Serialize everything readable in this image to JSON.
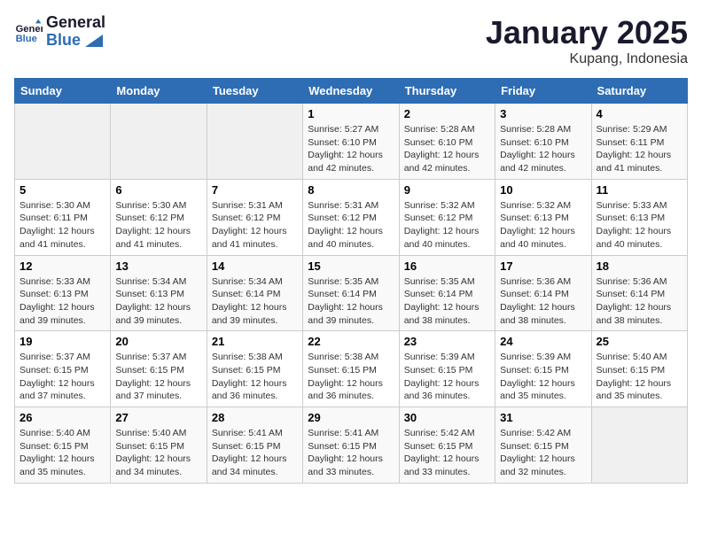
{
  "header": {
    "logo_line1": "General",
    "logo_line2": "Blue",
    "title": "January 2025",
    "subtitle": "Kupang, Indonesia"
  },
  "weekdays": [
    "Sunday",
    "Monday",
    "Tuesday",
    "Wednesday",
    "Thursday",
    "Friday",
    "Saturday"
  ],
  "weeks": [
    [
      {
        "day": "",
        "sunrise": "",
        "sunset": "",
        "daylight": ""
      },
      {
        "day": "",
        "sunrise": "",
        "sunset": "",
        "daylight": ""
      },
      {
        "day": "",
        "sunrise": "",
        "sunset": "",
        "daylight": ""
      },
      {
        "day": "1",
        "sunrise": "Sunrise: 5:27 AM",
        "sunset": "Sunset: 6:10 PM",
        "daylight": "Daylight: 12 hours and 42 minutes."
      },
      {
        "day": "2",
        "sunrise": "Sunrise: 5:28 AM",
        "sunset": "Sunset: 6:10 PM",
        "daylight": "Daylight: 12 hours and 42 minutes."
      },
      {
        "day": "3",
        "sunrise": "Sunrise: 5:28 AM",
        "sunset": "Sunset: 6:10 PM",
        "daylight": "Daylight: 12 hours and 42 minutes."
      },
      {
        "day": "4",
        "sunrise": "Sunrise: 5:29 AM",
        "sunset": "Sunset: 6:11 PM",
        "daylight": "Daylight: 12 hours and 41 minutes."
      }
    ],
    [
      {
        "day": "5",
        "sunrise": "Sunrise: 5:30 AM",
        "sunset": "Sunset: 6:11 PM",
        "daylight": "Daylight: 12 hours and 41 minutes."
      },
      {
        "day": "6",
        "sunrise": "Sunrise: 5:30 AM",
        "sunset": "Sunset: 6:12 PM",
        "daylight": "Daylight: 12 hours and 41 minutes."
      },
      {
        "day": "7",
        "sunrise": "Sunrise: 5:31 AM",
        "sunset": "Sunset: 6:12 PM",
        "daylight": "Daylight: 12 hours and 41 minutes."
      },
      {
        "day": "8",
        "sunrise": "Sunrise: 5:31 AM",
        "sunset": "Sunset: 6:12 PM",
        "daylight": "Daylight: 12 hours and 40 minutes."
      },
      {
        "day": "9",
        "sunrise": "Sunrise: 5:32 AM",
        "sunset": "Sunset: 6:12 PM",
        "daylight": "Daylight: 12 hours and 40 minutes."
      },
      {
        "day": "10",
        "sunrise": "Sunrise: 5:32 AM",
        "sunset": "Sunset: 6:13 PM",
        "daylight": "Daylight: 12 hours and 40 minutes."
      },
      {
        "day": "11",
        "sunrise": "Sunrise: 5:33 AM",
        "sunset": "Sunset: 6:13 PM",
        "daylight": "Daylight: 12 hours and 40 minutes."
      }
    ],
    [
      {
        "day": "12",
        "sunrise": "Sunrise: 5:33 AM",
        "sunset": "Sunset: 6:13 PM",
        "daylight": "Daylight: 12 hours and 39 minutes."
      },
      {
        "day": "13",
        "sunrise": "Sunrise: 5:34 AM",
        "sunset": "Sunset: 6:13 PM",
        "daylight": "Daylight: 12 hours and 39 minutes."
      },
      {
        "day": "14",
        "sunrise": "Sunrise: 5:34 AM",
        "sunset": "Sunset: 6:14 PM",
        "daylight": "Daylight: 12 hours and 39 minutes."
      },
      {
        "day": "15",
        "sunrise": "Sunrise: 5:35 AM",
        "sunset": "Sunset: 6:14 PM",
        "daylight": "Daylight: 12 hours and 39 minutes."
      },
      {
        "day": "16",
        "sunrise": "Sunrise: 5:35 AM",
        "sunset": "Sunset: 6:14 PM",
        "daylight": "Daylight: 12 hours and 38 minutes."
      },
      {
        "day": "17",
        "sunrise": "Sunrise: 5:36 AM",
        "sunset": "Sunset: 6:14 PM",
        "daylight": "Daylight: 12 hours and 38 minutes."
      },
      {
        "day": "18",
        "sunrise": "Sunrise: 5:36 AM",
        "sunset": "Sunset: 6:14 PM",
        "daylight": "Daylight: 12 hours and 38 minutes."
      }
    ],
    [
      {
        "day": "19",
        "sunrise": "Sunrise: 5:37 AM",
        "sunset": "Sunset: 6:15 PM",
        "daylight": "Daylight: 12 hours and 37 minutes."
      },
      {
        "day": "20",
        "sunrise": "Sunrise: 5:37 AM",
        "sunset": "Sunset: 6:15 PM",
        "daylight": "Daylight: 12 hours and 37 minutes."
      },
      {
        "day": "21",
        "sunrise": "Sunrise: 5:38 AM",
        "sunset": "Sunset: 6:15 PM",
        "daylight": "Daylight: 12 hours and 36 minutes."
      },
      {
        "day": "22",
        "sunrise": "Sunrise: 5:38 AM",
        "sunset": "Sunset: 6:15 PM",
        "daylight": "Daylight: 12 hours and 36 minutes."
      },
      {
        "day": "23",
        "sunrise": "Sunrise: 5:39 AM",
        "sunset": "Sunset: 6:15 PM",
        "daylight": "Daylight: 12 hours and 36 minutes."
      },
      {
        "day": "24",
        "sunrise": "Sunrise: 5:39 AM",
        "sunset": "Sunset: 6:15 PM",
        "daylight": "Daylight: 12 hours and 35 minutes."
      },
      {
        "day": "25",
        "sunrise": "Sunrise: 5:40 AM",
        "sunset": "Sunset: 6:15 PM",
        "daylight": "Daylight: 12 hours and 35 minutes."
      }
    ],
    [
      {
        "day": "26",
        "sunrise": "Sunrise: 5:40 AM",
        "sunset": "Sunset: 6:15 PM",
        "daylight": "Daylight: 12 hours and 35 minutes."
      },
      {
        "day": "27",
        "sunrise": "Sunrise: 5:40 AM",
        "sunset": "Sunset: 6:15 PM",
        "daylight": "Daylight: 12 hours and 34 minutes."
      },
      {
        "day": "28",
        "sunrise": "Sunrise: 5:41 AM",
        "sunset": "Sunset: 6:15 PM",
        "daylight": "Daylight: 12 hours and 34 minutes."
      },
      {
        "day": "29",
        "sunrise": "Sunrise: 5:41 AM",
        "sunset": "Sunset: 6:15 PM",
        "daylight": "Daylight: 12 hours and 33 minutes."
      },
      {
        "day": "30",
        "sunrise": "Sunrise: 5:42 AM",
        "sunset": "Sunset: 6:15 PM",
        "daylight": "Daylight: 12 hours and 33 minutes."
      },
      {
        "day": "31",
        "sunrise": "Sunrise: 5:42 AM",
        "sunset": "Sunset: 6:15 PM",
        "daylight": "Daylight: 12 hours and 32 minutes."
      },
      {
        "day": "",
        "sunrise": "",
        "sunset": "",
        "daylight": ""
      }
    ]
  ]
}
